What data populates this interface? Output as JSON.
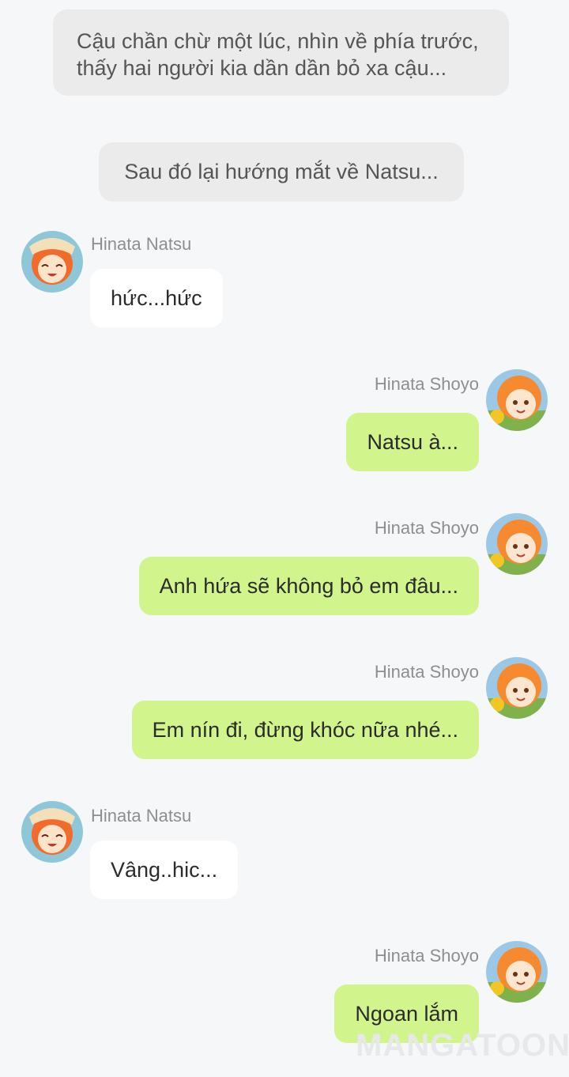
{
  "narrations": [
    "Cậu chần chừ một lúc, nhìn về phía trước, thấy hai người kia dần dần bỏ xa cậu...",
    "Sau đó lại hướng mắt về Natsu..."
  ],
  "messages": [
    {
      "side": "left",
      "sender": "Hinata Natsu",
      "text": "hức...hức"
    },
    {
      "side": "right",
      "sender": "Hinata Shoyo",
      "text": "Natsu à..."
    },
    {
      "side": "right",
      "sender": "Hinata Shoyo",
      "text": "Anh hứa sẽ không bỏ em đâu..."
    },
    {
      "side": "right",
      "sender": "Hinata Shoyo",
      "text": "Em nín đi, đừng khóc nữa nhé..."
    },
    {
      "side": "left",
      "sender": "Hinata Natsu",
      "text": "Vâng..hic..."
    },
    {
      "side": "right",
      "sender": "Hinata Shoyo",
      "text": "Ngoan lắm"
    }
  ],
  "watermark": "MANGATOON",
  "colors": {
    "background": "#f5f7f9",
    "narration_bg": "#ebebeb",
    "bubble_left": "#ffffff",
    "bubble_right": "#d2f48c",
    "name_text": "#8e8e8e"
  }
}
